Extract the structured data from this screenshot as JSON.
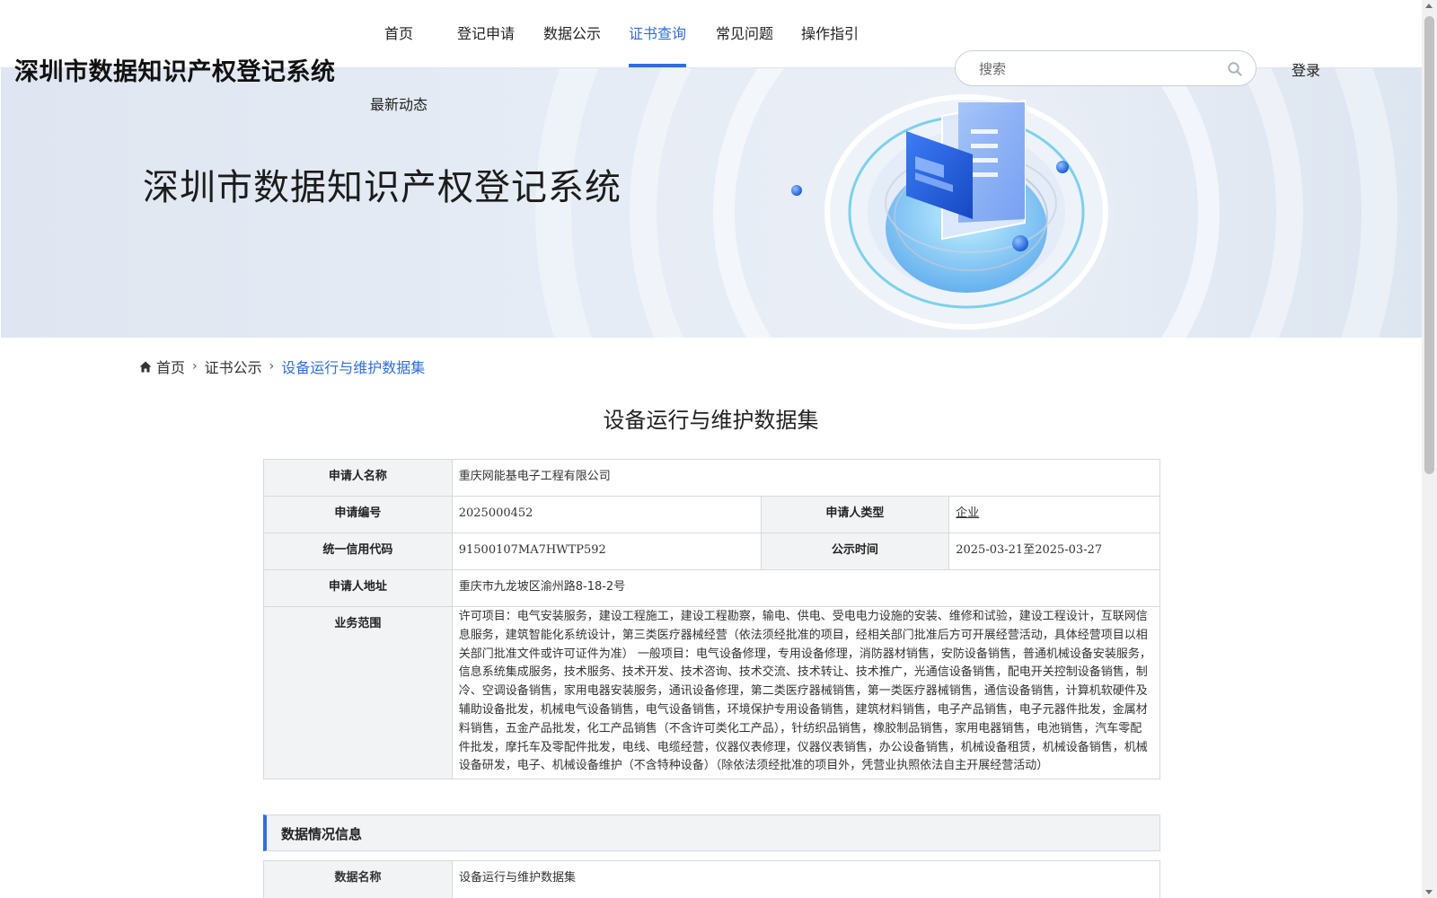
{
  "site": {
    "title": "深圳市数据知识产权登记系统"
  },
  "nav": {
    "items": [
      {
        "label": "首页"
      },
      {
        "label": "登记申请"
      },
      {
        "label": "数据公示"
      },
      {
        "label": "证书查询",
        "active": true
      },
      {
        "label": "常见问题"
      },
      {
        "label": "操作指引"
      },
      {
        "label": "最新动态"
      }
    ]
  },
  "search": {
    "placeholder": "搜索",
    "icon": "search-icon"
  },
  "login": {
    "label": "登录"
  },
  "banner": {
    "title": "深圳市数据知识产权登记系统"
  },
  "breadcrumb": {
    "home": "首页",
    "level2": "证书公示",
    "current": "设备运行与维护数据集",
    "home_icon": "home-icon"
  },
  "page": {
    "title": "设备运行与维护数据集"
  },
  "applicant": {
    "name_label": "申请人名称",
    "name": "重庆网能基电子工程有限公司",
    "app_no_label": "申请编号",
    "app_no": "2025000452",
    "type_label": "申请人类型",
    "type": "企业",
    "credit_code_label": "统一信用代码",
    "credit_code": "91500107MA7HWTP592",
    "publicity_label": "公示时间",
    "publicity": "2025-03-21至2025-03-27",
    "address_label": "申请人地址",
    "address": "重庆市九龙坡区渝州路8-18-2号",
    "scope_label": "业务范围",
    "scope": "许可项目：电气安装服务，建设工程施工，建设工程勘察，输电、供电、受电电力设施的安装、维修和试验，建设工程设计，互联网信息服务，建筑智能化系统设计，第三类医疗器械经营（依法须经批准的项目，经相关部门批准后方可开展经营活动，具体经营项目以相关部门批准文件或许可证件为准） 一般项目：电气设备修理，专用设备修理，消防器材销售，安防设备销售，普通机械设备安装服务，信息系统集成服务，技术服务、技术开发、技术咨询、技术交流、技术转让、技术推广，光通信设备销售，配电开关控制设备销售，制冷、空调设备销售，家用电器安装服务，通讯设备修理，第二类医疗器械销售，第一类医疗器械销售，通信设备销售，计算机软硬件及辅助设备批发，机械电气设备销售，电气设备销售，环境保护专用设备销售，建筑材料销售，电子产品销售，电子元器件批发，金属材料销售，五金产品批发，化工产品销售（不含许可类化工产品），针纺织品销售，橡胶制品销售，家用电器销售，电池销售，汽车零配件批发，摩托车及零配件批发，电线、电缆经营，仪器仪表修理，仪器仪表销售，办公设备销售，机械设备租赁，机械设备销售，机械设备研发，电子、机械设备维护（不含特种设备）（除依法须经批准的项目外，凭营业执照依法自主开展经营活动）"
  },
  "data_section": {
    "title": "数据情况信息",
    "name_label": "数据名称",
    "name": "设备运行与维护数据集"
  },
  "colors": {
    "accent": "#2f6ee0",
    "label_bg": "#f2f3f5",
    "border": "#d6d9de"
  }
}
